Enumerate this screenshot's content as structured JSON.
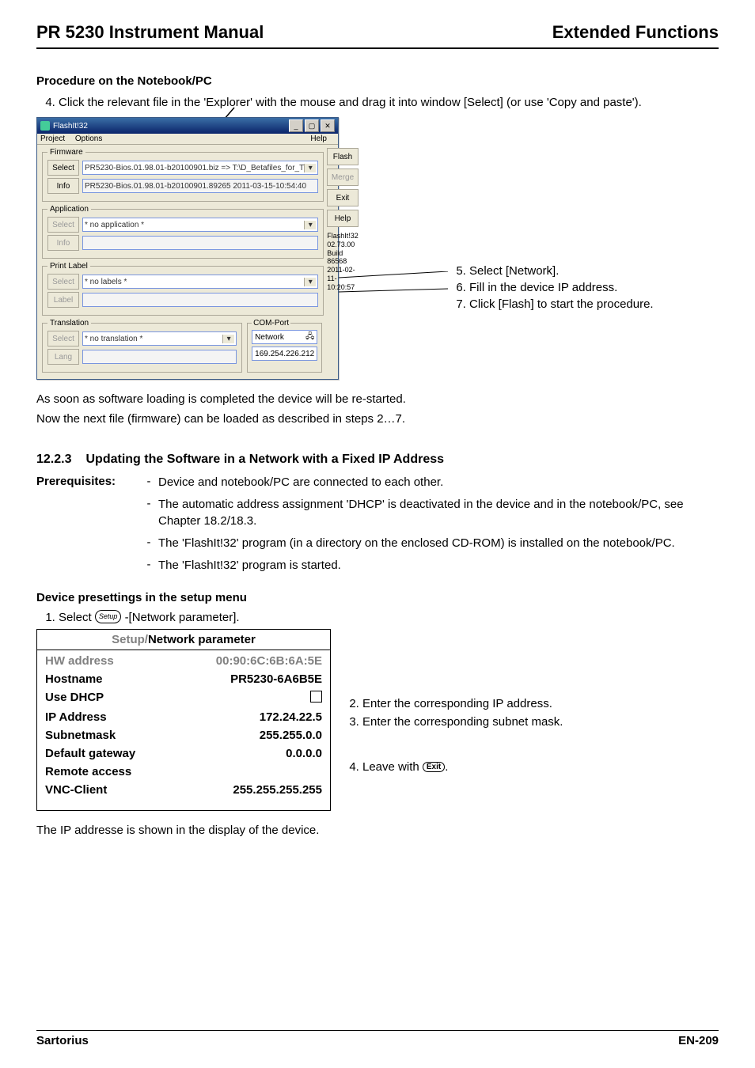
{
  "header": {
    "title_left": "PR 5230 Instrument Manual",
    "title_right": "Extended Functions"
  },
  "procedure": {
    "heading": "Procedure on the Notebook/PC",
    "step4": "Click the relevant file in the 'Explorer' with the mouse and drag it into window [Select] (or use 'Copy and paste')."
  },
  "app": {
    "title": "FlashIt!32",
    "menu": {
      "project": "Project",
      "options": "Options",
      "help": "Help"
    },
    "btns": {
      "flash": "Flash",
      "merge": "Merge",
      "exit": "Exit",
      "help": "Help"
    },
    "version_lines": [
      "FlashIt!32",
      "02.73.00",
      "Build 86568",
      "2011-02-11-10:20:57"
    ],
    "firmware": {
      "legend": "Firmware",
      "select_label": "Select",
      "info_label": "Info",
      "select_value": "PR5230-Bios.01.98.01-b20100901.biz => T:\\D_Betafiles_for_T",
      "info_value": "PR5230-Bios.01.98.01-b20100901.89265 2011-03-15-10:54:40"
    },
    "application": {
      "legend": "Application",
      "select_label": "Select",
      "info_label": "Info",
      "select_value": "* no application *"
    },
    "printlabel": {
      "legend": "Print Label",
      "select_label": "Select",
      "info_label": "Label",
      "select_value": "* no labels *"
    },
    "translation": {
      "legend": "Translation",
      "select_label": "Select",
      "info_label": "Lang",
      "select_value": "* no translation *"
    },
    "comport": {
      "legend": "COM-Port",
      "port_value": "Network",
      "ip_value": "169.254.226.212"
    }
  },
  "side_steps": {
    "s5": "Select [Network].",
    "s6": "Fill in the device IP address.",
    "s7": "Click [Flash] to start the procedure."
  },
  "after": {
    "line1": "As soon as software loading is completed the device will be re-started.",
    "line2": "Now the next file (firmware) can be loaded as described in steps 2…7."
  },
  "section": {
    "num": "12.2.3",
    "title": "Updating the Software in a Network with a Fixed IP Address"
  },
  "prereq": {
    "label": "Prerequisites:",
    "items": [
      "Device and notebook/PC are connected to each other.",
      "The automatic address assignment 'DHCP' is deactivated in the device and in the notebook/PC, see Chapter 18.2/18.3.",
      "The 'FlashIt!32' program (in a directory on the enclosed CD-ROM) is installed on the notebook/PC.",
      "The 'FlashIt!32' program is started."
    ]
  },
  "device": {
    "heading": "Device presettings in the setup menu",
    "step1_pre": "Select ",
    "step1_post": "-[Network parameter].",
    "setup_icon": "Setup"
  },
  "panel": {
    "title_grey": "Setup/",
    "title_black": "Network parameter",
    "rows": [
      {
        "k": "HW address",
        "v": "00:90:6C:6B:6A:5E",
        "grey": true
      },
      {
        "k": "Hostname",
        "v": "PR5230-6A6B5E"
      },
      {
        "k": "Use DHCP",
        "v": "[checkbox]"
      },
      {
        "k": "IP Address",
        "v": "172.24.22.5"
      },
      {
        "k": "Subnetmask",
        "v": "255.255.0.0"
      },
      {
        "k": "Default gateway",
        "v": "0.0.0.0"
      },
      {
        "k": "Remote access",
        "v": ""
      },
      {
        "k": "VNC-Client",
        "v": "255.255.255.255"
      }
    ]
  },
  "panel_side": {
    "s2": "Enter the corresponding IP address.",
    "s3": "Enter the corresponding subnet mask.",
    "s4_pre": "Leave with ",
    "s4_icon": "Exit",
    "s4_post": "."
  },
  "after2": "The IP addresse is shown in the display of the device.",
  "footer": {
    "brand": "Sartorius",
    "page": "EN-209"
  }
}
